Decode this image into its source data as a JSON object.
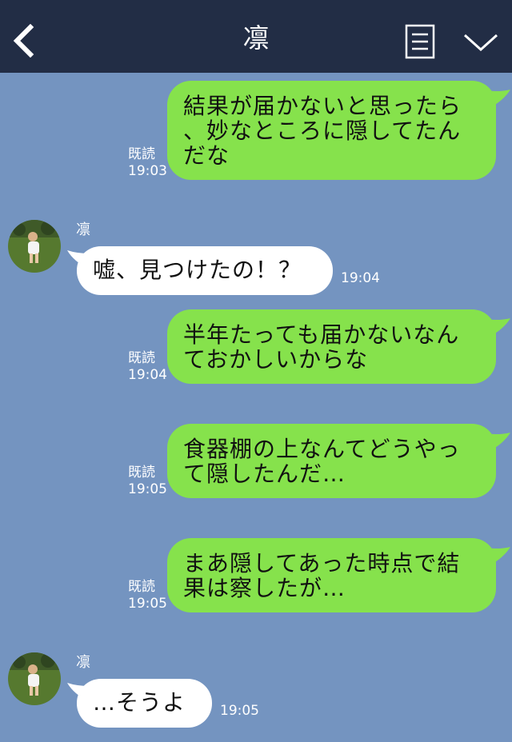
{
  "header": {
    "title": "凛"
  },
  "icons": {
    "back": "chevron-left-icon",
    "menu": "note-menu-icon",
    "expand": "chevron-down-icon"
  },
  "colors": {
    "header": "#222d45",
    "background": "#7494c0",
    "outgoing_bubble": "#86e24c",
    "incoming_bubble": "#ffffff"
  },
  "messages": [
    {
      "direction": "out",
      "text": "結果が届かないと思ったら\n、妙なところに隠してたん\nだな",
      "read": "既読",
      "time": "19:03"
    },
    {
      "direction": "in",
      "sender": "凛",
      "text": "嘘、見つけたの！？",
      "time": "19:04"
    },
    {
      "direction": "out",
      "text": "半年たっても届かないなん\nておかしいからな",
      "read": "既読",
      "time": "19:04"
    },
    {
      "direction": "out",
      "text": "食器棚の上なんてどうやっ\nて隠したんだ…",
      "read": "既読",
      "time": "19:05"
    },
    {
      "direction": "out",
      "text": "まあ隠してあった時点で結\n果は察したが…",
      "read": "既読",
      "time": "19:05"
    },
    {
      "direction": "in",
      "sender": "凛",
      "text": "…そうよ",
      "time": "19:05"
    }
  ]
}
